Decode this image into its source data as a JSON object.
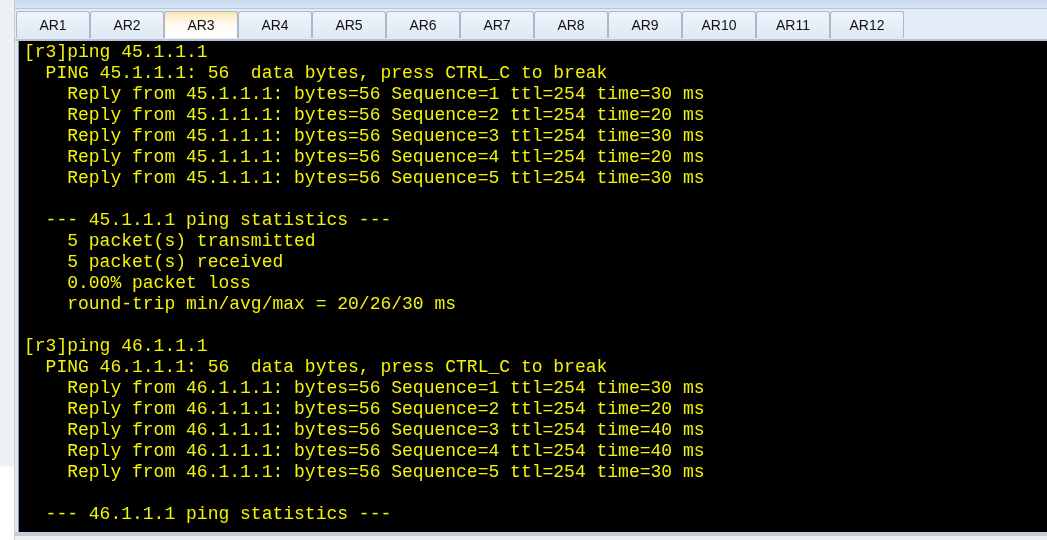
{
  "tabs": [
    {
      "label": "AR1",
      "selected": false
    },
    {
      "label": "AR2",
      "selected": false
    },
    {
      "label": "AR3",
      "selected": true
    },
    {
      "label": "AR4",
      "selected": false
    },
    {
      "label": "AR5",
      "selected": false
    },
    {
      "label": "AR6",
      "selected": false
    },
    {
      "label": "AR7",
      "selected": false
    },
    {
      "label": "AR8",
      "selected": false
    },
    {
      "label": "AR9",
      "selected": false
    },
    {
      "label": "AR10",
      "selected": false
    },
    {
      "label": "AR11",
      "selected": false
    },
    {
      "label": "AR12",
      "selected": false
    }
  ],
  "terminal": {
    "blocks": [
      [
        "[r3]ping 45.1.1.1",
        "  PING 45.1.1.1: 56  data bytes, press CTRL_C to break",
        "    Reply from 45.1.1.1: bytes=56 Sequence=1 ttl=254 time=30 ms",
        "    Reply from 45.1.1.1: bytes=56 Sequence=2 ttl=254 time=20 ms",
        "    Reply from 45.1.1.1: bytes=56 Sequence=3 ttl=254 time=30 ms",
        "    Reply from 45.1.1.1: bytes=56 Sequence=4 ttl=254 time=20 ms",
        "    Reply from 45.1.1.1: bytes=56 Sequence=5 ttl=254 time=30 ms"
      ],
      [
        "  --- 45.1.1.1 ping statistics ---",
        "    5 packet(s) transmitted",
        "    5 packet(s) received",
        "    0.00% packet loss",
        "    round-trip min/avg/max = 20/26/30 ms"
      ],
      [
        "[r3]ping 46.1.1.1",
        "  PING 46.1.1.1: 56  data bytes, press CTRL_C to break",
        "    Reply from 46.1.1.1: bytes=56 Sequence=1 ttl=254 time=30 ms",
        "    Reply from 46.1.1.1: bytes=56 Sequence=2 ttl=254 time=20 ms",
        "    Reply from 46.1.1.1: bytes=56 Sequence=3 ttl=254 time=40 ms",
        "    Reply from 46.1.1.1: bytes=56 Sequence=4 ttl=254 time=40 ms",
        "    Reply from 46.1.1.1: bytes=56 Sequence=5 ttl=254 time=30 ms"
      ],
      [
        "  --- 46.1.1.1 ping statistics ---"
      ]
    ]
  }
}
